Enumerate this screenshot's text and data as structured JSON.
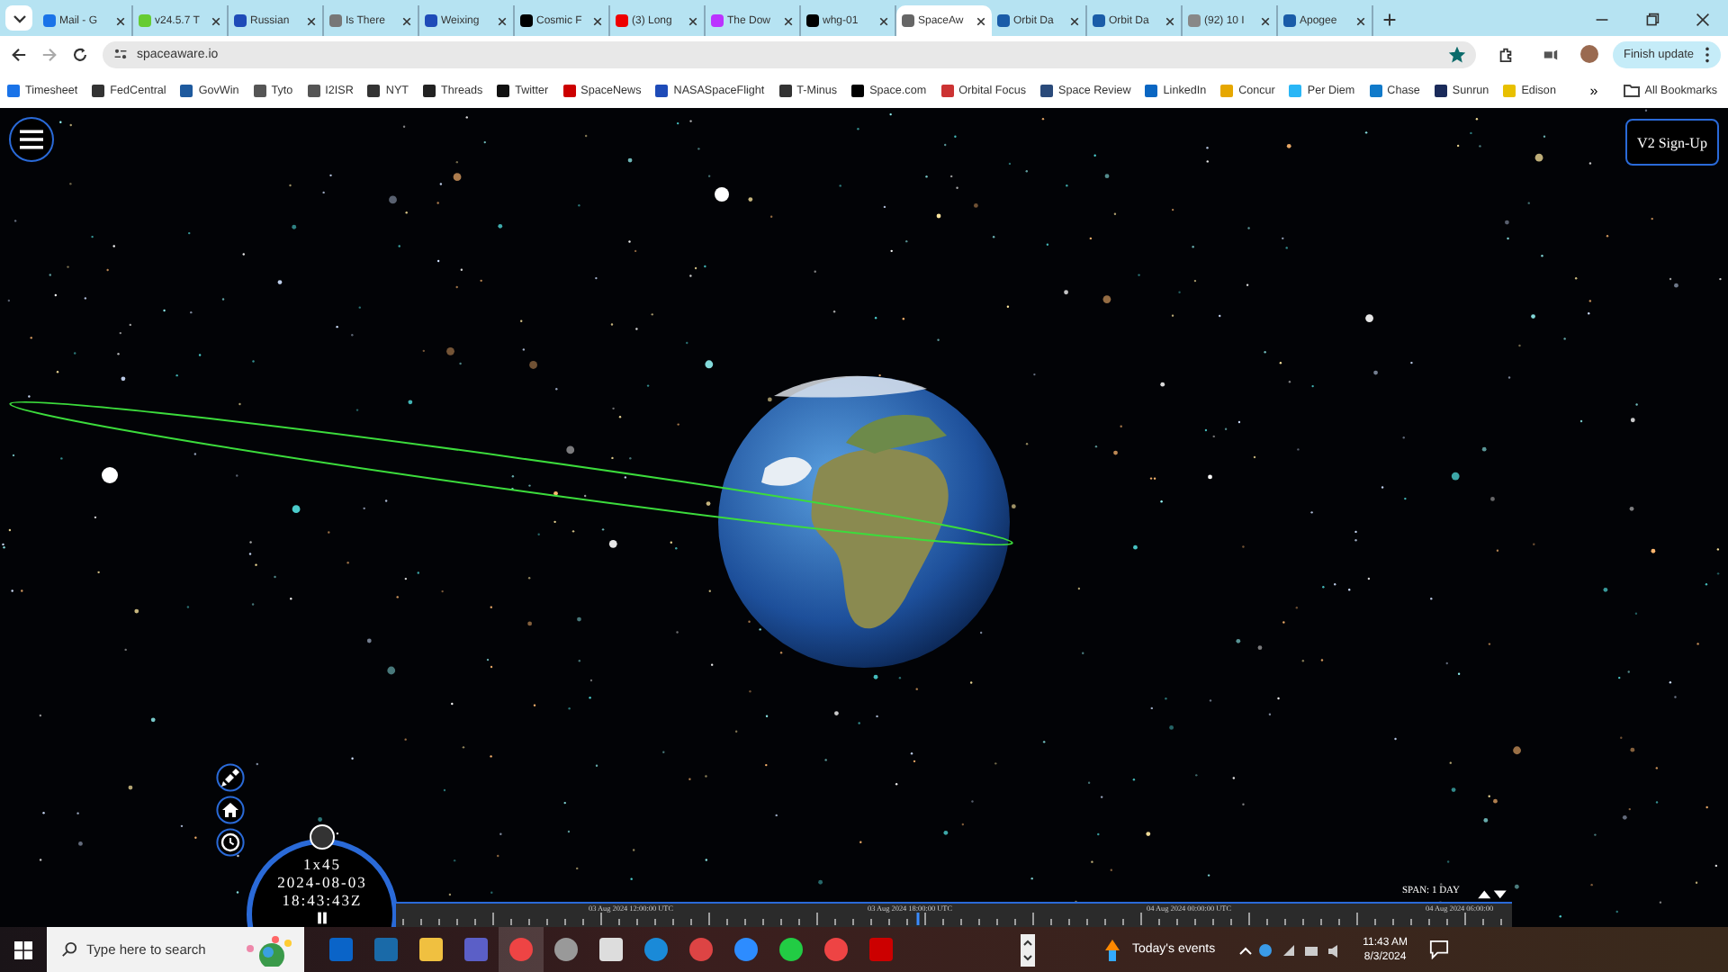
{
  "tabs": [
    {
      "title": "Mail - G",
      "selected": false
    },
    {
      "title": "v24.5.7 T",
      "selected": false
    },
    {
      "title": "Russian",
      "selected": false
    },
    {
      "title": "Is There",
      "selected": false
    },
    {
      "title": "Weixing",
      "selected": false
    },
    {
      "title": "Cosmic F",
      "selected": false
    },
    {
      "title": "(3) Long",
      "selected": false
    },
    {
      "title": "The Dow",
      "selected": false
    },
    {
      "title": "whg-01",
      "selected": false
    },
    {
      "title": "SpaceAw",
      "selected": true
    },
    {
      "title": "Orbit Da",
      "selected": false
    },
    {
      "title": "Orbit Da",
      "selected": false
    },
    {
      "title": "(92) 10 I",
      "selected": false
    },
    {
      "title": "Apogee",
      "selected": false
    }
  ],
  "address_bar": {
    "url": "spaceaware.io",
    "bookmarked": true
  },
  "update_button": "Finish update",
  "bookmarks": [
    "Timesheet",
    "FedCentral",
    "GovWin",
    "Tyto",
    "I2ISR",
    "NYT",
    "Threads",
    "Twitter",
    "SpaceNews",
    "NASASpaceFlight",
    "T-Minus",
    "Space.com",
    "Orbital Focus",
    "Space Review",
    "LinkedIn",
    "Concur",
    "Per Diem",
    "Chase",
    "Sunrun",
    "Edison"
  ],
  "bookmarks_more": "»",
  "all_bookmarks": "All Bookmarks",
  "app": {
    "signup_button": "V2 Sign-Up",
    "clock": {
      "speed": "1x45",
      "date": "2024-08-03",
      "time": "18:43:43Z",
      "paused": true
    },
    "timeline": {
      "span_label": "SPAN: 1 DAY",
      "labels": [
        "03 Aug 2024 12:00:00 UTC",
        "03 Aug 2024 18:00:00 UTC",
        "04 Aug 2024 00:00:00 UTC",
        "04 Aug 2024 06:00:00"
      ]
    }
  },
  "taskbar": {
    "search_placeholder": "Type here to search",
    "events": "Today's events",
    "time": "11:43 AM",
    "date": "8/3/2024"
  }
}
